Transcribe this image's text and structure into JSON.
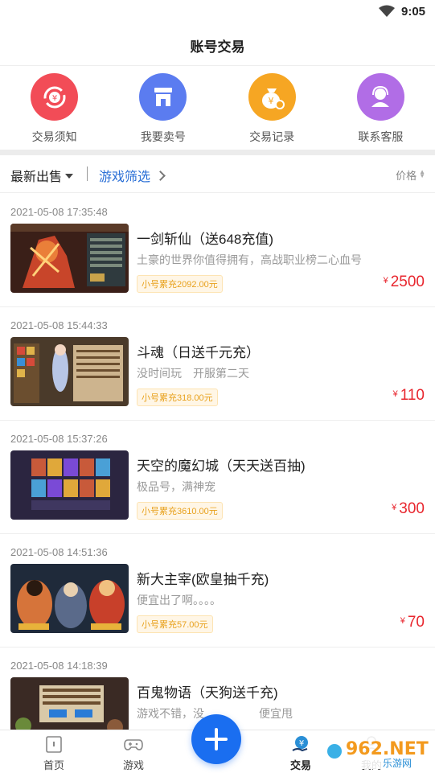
{
  "status": {
    "time": "9:05",
    "icon": "wifi-icon"
  },
  "header": {
    "title": "账号交易"
  },
  "quick_nav": [
    {
      "label": "交易须知",
      "icon": "exchange-icon",
      "color": "#f24c57"
    },
    {
      "label": "我要卖号",
      "icon": "shop-icon",
      "color": "#5b7cf0"
    },
    {
      "label": "交易记录",
      "icon": "money-bag-icon",
      "color": "#f6a623"
    },
    {
      "label": "联系客服",
      "icon": "customer-service-icon",
      "color": "#b16de6"
    }
  ],
  "filter": {
    "sort_label": "最新出售",
    "game_filter_label": "游戏筛选",
    "price_label": "价格"
  },
  "listings": [
    {
      "time": "2021-05-08 17:35:48",
      "name": "一剑斩仙（送648充值)",
      "desc": "土豪的世界你值得拥有，高战职业榜二心血号",
      "badge": "小号累充2092.00元",
      "price": "2500"
    },
    {
      "time": "2021-05-08 15:44:33",
      "name": "斗魂（日送千元充）",
      "desc": "没时间玩　开服第二天",
      "badge": "小号累充318.00元",
      "price": "110"
    },
    {
      "time": "2021-05-08 15:37:26",
      "name": "天空的魔幻城（天天送百抽)",
      "desc": "极品号，满神宠",
      "badge": "小号累充3610.00元",
      "price": "300"
    },
    {
      "time": "2021-05-08 14:51:36",
      "name": "新大主宰(欧皇抽千充)",
      "desc": "便宜出了啊。。。。",
      "badge": "小号累充57.00元",
      "price": "70"
    },
    {
      "time": "2021-05-08 14:18:39",
      "name": "百鬼物语（天狗送千充)",
      "desc": "游戏不错，没",
      "desc2": "便宜甩",
      "badge": "",
      "price": ""
    }
  ],
  "currency": "¥",
  "bottom_nav": [
    {
      "label": "首页",
      "icon": "home-icon"
    },
    {
      "label": "游戏",
      "icon": "gamepad-icon"
    },
    {
      "label": "交易",
      "icon": "trade-icon"
    },
    {
      "label": "我的",
      "icon": "user-icon"
    }
  ],
  "watermark": {
    "text": "962.NET",
    "subtext": "乐游网"
  },
  "colors": {
    "accent": "#1a6ef0",
    "price": "#e8262e",
    "link": "#2a6fd6"
  }
}
